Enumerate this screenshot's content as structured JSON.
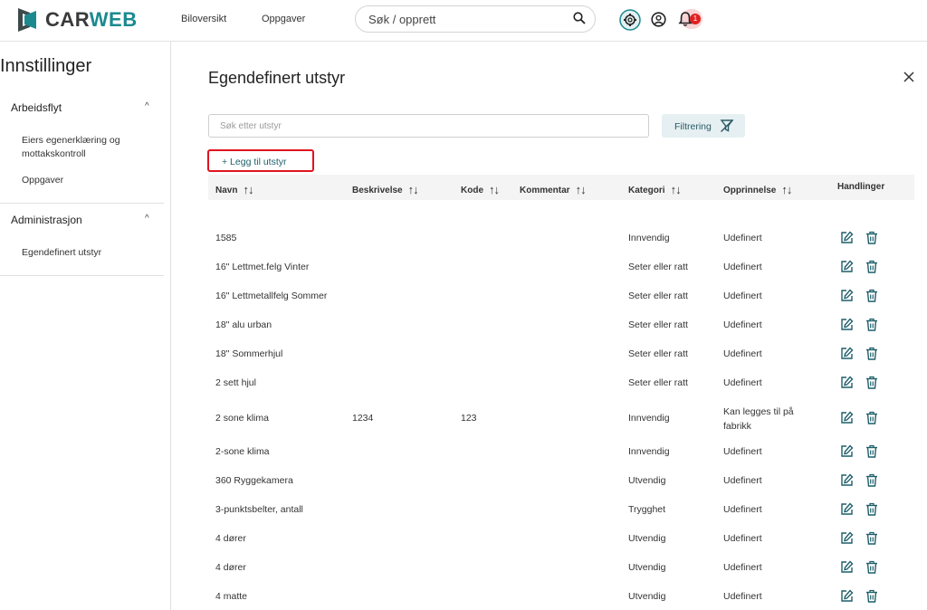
{
  "brand": {
    "part1": "CAR",
    "part2": "WEB"
  },
  "nav": {
    "vehicles": "Biloversikt",
    "tasks": "Oppgaver"
  },
  "search": {
    "placeholder": "Søk / opprett"
  },
  "notifications": {
    "count": "1"
  },
  "sidebar": {
    "title": "Innstillinger",
    "sections": [
      {
        "label": "Arbeidsflyt",
        "items": [
          "Eiers egenerklæring og mottakskontroll",
          "Oppgaver"
        ]
      },
      {
        "label": "Administrasjon",
        "items": [
          "Egendefinert utstyr"
        ]
      }
    ]
  },
  "main": {
    "title": "Egendefinert utstyr",
    "filter_placeholder": "Søk etter utstyr",
    "filter_button": "Filtrering",
    "add_button": "+ Legg til utstyr"
  },
  "table": {
    "columns": [
      "Navn",
      "Beskrivelse",
      "Kode",
      "Kommentar",
      "Kategori",
      "Opprinnelse",
      "Handlinger"
    ],
    "sort_glyph": "↑↓",
    "rows": [
      {
        "name": "1585",
        "desc": "",
        "code": "",
        "comment": "",
        "category": "Innvendig",
        "origin": "Udefinert"
      },
      {
        "name": "16\" Lettmet.felg Vinter",
        "desc": "",
        "code": "",
        "comment": "",
        "category": "Seter eller ratt",
        "origin": "Udefinert"
      },
      {
        "name": "16\" Lettmetallfelg Sommer",
        "desc": "",
        "code": "",
        "comment": "",
        "category": "Seter eller ratt",
        "origin": "Udefinert"
      },
      {
        "name": "18\" alu urban",
        "desc": "",
        "code": "",
        "comment": "",
        "category": "Seter eller ratt",
        "origin": "Udefinert"
      },
      {
        "name": "18\" Sommerhjul",
        "desc": "",
        "code": "",
        "comment": "",
        "category": "Seter eller ratt",
        "origin": "Udefinert"
      },
      {
        "name": "2 sett hjul",
        "desc": "",
        "code": "",
        "comment": "",
        "category": "Seter eller ratt",
        "origin": "Udefinert"
      },
      {
        "name": "2 sone klima",
        "desc": "1234",
        "code": "123",
        "comment": "",
        "category": "Innvendig",
        "origin": "Kan legges til på fabrikk"
      },
      {
        "name": "2-sone klima",
        "desc": "",
        "code": "",
        "comment": "",
        "category": "Innvendig",
        "origin": "Udefinert"
      },
      {
        "name": "360 Ryggekamera",
        "desc": "",
        "code": "",
        "comment": "",
        "category": "Utvendig",
        "origin": "Udefinert"
      },
      {
        "name": "3-punktsbelter, antall",
        "desc": "",
        "code": "",
        "comment": "",
        "category": "Trygghet",
        "origin": "Udefinert"
      },
      {
        "name": "4 dører",
        "desc": "",
        "code": "",
        "comment": "",
        "category": "Utvendig",
        "origin": "Udefinert"
      },
      {
        "name": "4 dører",
        "desc": "",
        "code": "",
        "comment": "",
        "category": "Utvendig",
        "origin": "Udefinert"
      },
      {
        "name": "4 matte",
        "desc": "",
        "code": "",
        "comment": "",
        "category": "Utvendig",
        "origin": "Udefinert"
      }
    ]
  },
  "colors": {
    "accent": "#1b8a8f",
    "highlight": "#e0141f",
    "icon": "#1f5f6a"
  }
}
